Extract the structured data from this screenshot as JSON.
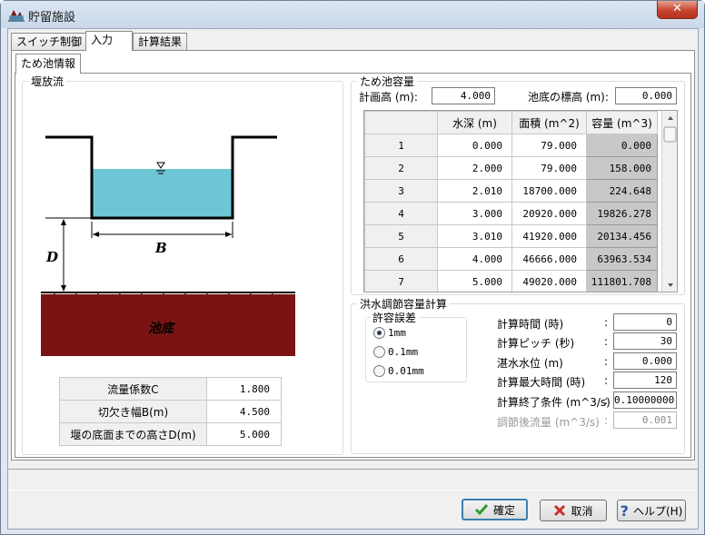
{
  "window": {
    "title": "貯留施設",
    "close_label": "✕"
  },
  "tabs": [
    {
      "label": "スイッチ制御"
    },
    {
      "label": "入力"
    },
    {
      "label": "計算結果"
    }
  ],
  "subtab": {
    "label": "ため池情報"
  },
  "weir": {
    "legend": "堰放流",
    "diagram": {
      "label_B": "B",
      "label_D": "D",
      "label_bottom": "池底"
    },
    "params": [
      {
        "label": "流量係数C",
        "value": "1.800"
      },
      {
        "label": "切欠き幅B(m)",
        "value": "4.500"
      },
      {
        "label": "堰の底面までの高さD(m)",
        "value": "5.000"
      }
    ]
  },
  "capacity": {
    "legend": "ため池容量",
    "plan_height_label": "計画高 (m):",
    "plan_height_value": "4.000",
    "bottom_elev_label": "池底の標高 (m):",
    "bottom_elev_value": "0.000",
    "headers": [
      "",
      "水深 (m)",
      "面積 (m^2)",
      "容量 (m^3)"
    ],
    "rows": [
      {
        "no": "1",
        "depth": "0.000",
        "area": "79.000",
        "volume": "0.000"
      },
      {
        "no": "2",
        "depth": "2.000",
        "area": "79.000",
        "volume": "158.000"
      },
      {
        "no": "3",
        "depth": "2.010",
        "area": "18700.000",
        "volume": "224.648"
      },
      {
        "no": "4",
        "depth": "3.000",
        "area": "20920.000",
        "volume": "19826.278"
      },
      {
        "no": "5",
        "depth": "3.010",
        "area": "41920.000",
        "volume": "20134.456"
      },
      {
        "no": "6",
        "depth": "4.000",
        "area": "46666.000",
        "volume": "63963.534"
      },
      {
        "no": "7",
        "depth": "5.000",
        "area": "49020.000",
        "volume": "111801.708"
      }
    ]
  },
  "flood": {
    "legend": "洪水調節容量計算",
    "tolerance": {
      "legend": "許容誤差",
      "options": [
        "1mm",
        "0.1mm",
        "0.01mm"
      ],
      "selected": "1mm"
    },
    "fields": [
      {
        "label": "計算時間 (時)",
        "value": "0",
        "disabled": false
      },
      {
        "label": "計算ピッチ (秒)",
        "value": "30",
        "disabled": false
      },
      {
        "label": "湛水水位 (m)",
        "value": "0.000",
        "disabled": false
      },
      {
        "label": "計算最大時間 (時)",
        "value": "120",
        "disabled": false
      },
      {
        "label": "計算終了条件 (m^3/s)",
        "value": "0.10000000",
        "disabled": false
      },
      {
        "label": "調節後流量 (m^3/s)",
        "value": "0.001",
        "disabled": true
      }
    ],
    "colon": ":"
  },
  "buttons": {
    "ok": "確定",
    "cancel": "取消",
    "help": "ヘルプ(H)"
  },
  "colors": {
    "water": "#6ec6d4",
    "ground": "#7a1414",
    "accent_green": "#2e9a2e",
    "cancel_red": "#c83228",
    "help_blue": "#2c5aa0"
  }
}
